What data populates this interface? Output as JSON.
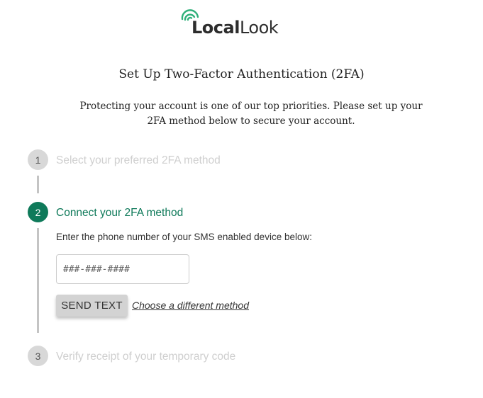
{
  "brand": {
    "name_bold": "Local",
    "name_light": "Look",
    "accent_color": "#0f7a5a",
    "logo_icon": "concentric-arcs-icon"
  },
  "header": {
    "title": "Set Up Two-Factor Authentication (2FA)",
    "intro": "Protecting your account is one of our top priorities. Please set up your 2FA method below to secure your account."
  },
  "steps": [
    {
      "number": "1",
      "label": "Select your preferred 2FA method",
      "state": "inactive"
    },
    {
      "number": "2",
      "label": "Connect your 2FA method",
      "state": "active"
    },
    {
      "number": "3",
      "label": "Verify receipt of your temporary code",
      "state": "inactive"
    }
  ],
  "connect": {
    "instruction": "Enter the phone number of your SMS enabled device below:",
    "phone_placeholder": "###-###-####",
    "send_label": "SEND TEXT",
    "alt_link": "Choose a different method"
  }
}
